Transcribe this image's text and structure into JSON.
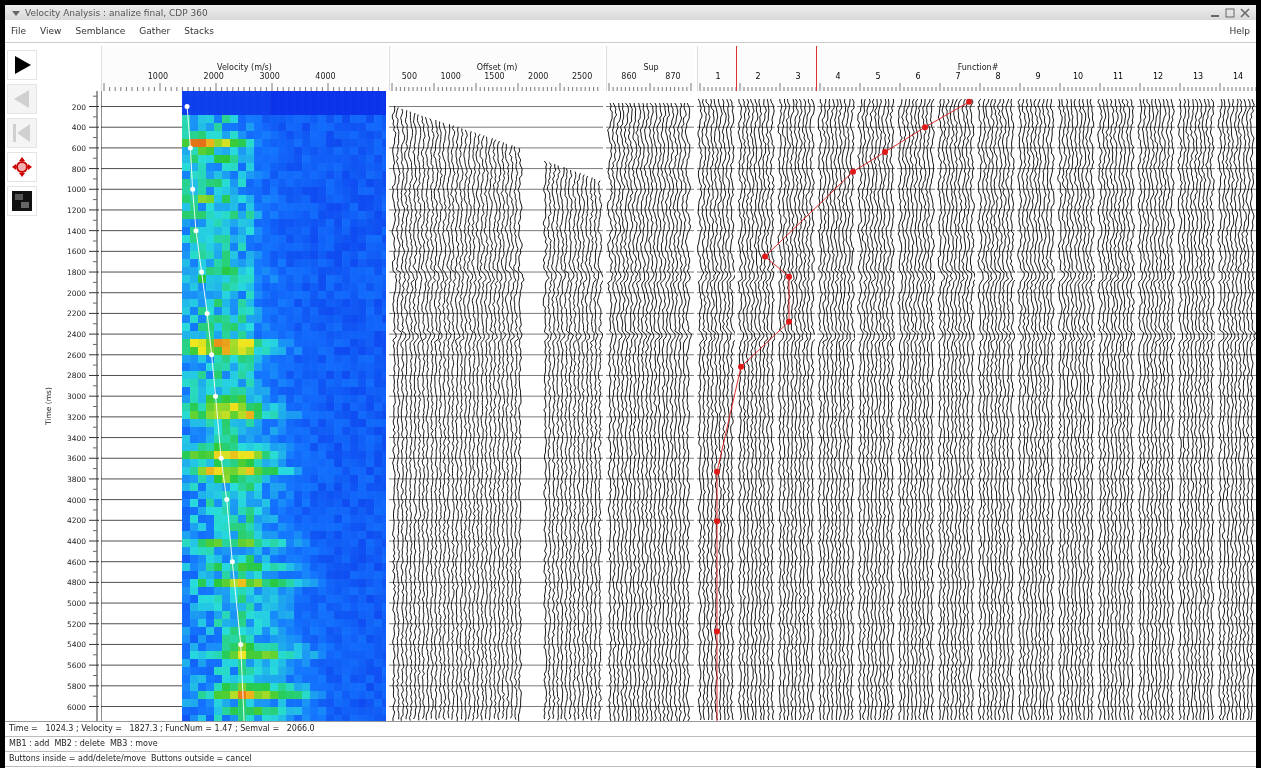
{
  "window": {
    "title": "Velocity Analysis : analize final, CDP 360"
  },
  "menu": [
    "File",
    "View",
    "Semblance",
    "Gather",
    "Stacks"
  ],
  "help": "Help",
  "toolbar": [
    {
      "kind": "play",
      "disabled": false
    },
    {
      "kind": "previous",
      "disabled": true
    },
    {
      "kind": "first",
      "disabled": true
    },
    {
      "kind": "move",
      "disabled": false
    },
    {
      "kind": "image",
      "disabled": false
    }
  ],
  "time_axis": {
    "title": "Time (ms)",
    "ticks": [
      "200",
      "400",
      "600",
      "800",
      "1000",
      "1200",
      "1400",
      "1600",
      "1800",
      "2000",
      "2200",
      "2400",
      "2600",
      "2800",
      "3000",
      "3200",
      "3400",
      "3600",
      "3800",
      "4000",
      "4200",
      "4400",
      "4600",
      "4800",
      "5000",
      "5200",
      "5400",
      "5600",
      "5800",
      "6000"
    ]
  },
  "semblance": {
    "title": "Velocity (m/s)",
    "ticks": [
      "1000",
      "2000",
      "3000",
      "4000"
    ]
  },
  "gather": {
    "title": "Offset (m)",
    "ticks": [
      "500",
      "1000",
      "1500",
      "2000",
      "2500"
    ]
  },
  "stack": {
    "title": "Sup",
    "ticks": [
      "860",
      "870"
    ]
  },
  "functions": {
    "title": "Function#",
    "ticks": [
      "1",
      "2",
      "3",
      "4",
      "5",
      "6",
      "7",
      "8",
      "9",
      "10",
      "11",
      "12",
      "13",
      "14"
    ]
  },
  "status_lines": [
    "Time =   1024.3 ; Velocity =   1827.3 ; FuncNum = 1.47 ; Semval =   2066.0",
    "MB1 : add  MB2 : delete  MB3 : move",
    "Buttons inside = add/delete/move  Buttons outside = cancel"
  ]
}
